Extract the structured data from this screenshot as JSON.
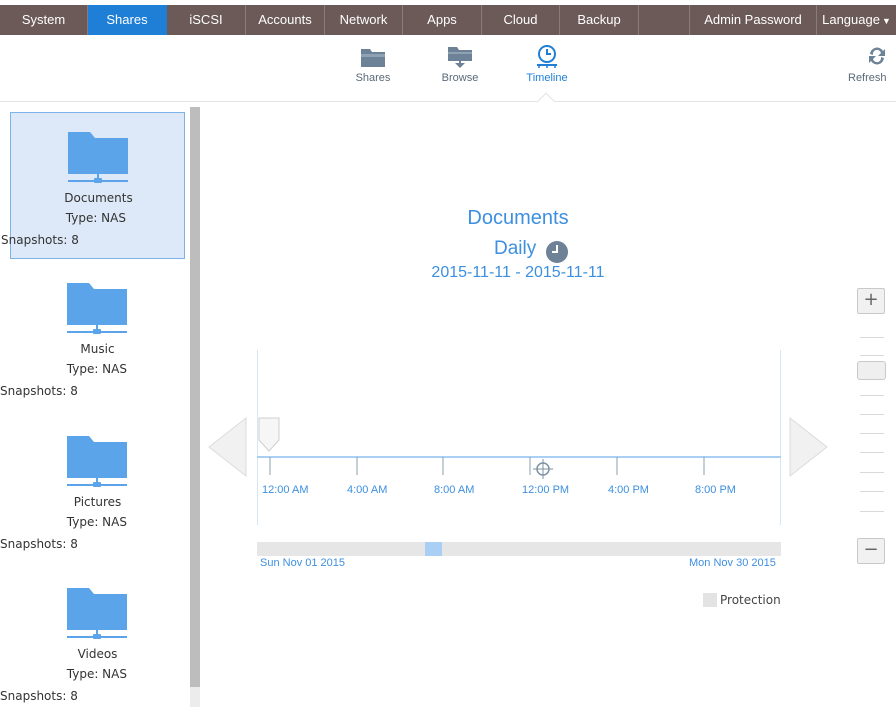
{
  "nav": {
    "tabs": [
      {
        "label": "System"
      },
      {
        "label": "Shares"
      },
      {
        "label": "iSCSI"
      },
      {
        "label": "Accounts"
      },
      {
        "label": "Network"
      },
      {
        "label": "Apps"
      },
      {
        "label": "Cloud"
      },
      {
        "label": "Backup"
      },
      {
        "label": ""
      },
      {
        "label": "Admin Password"
      },
      {
        "label": "Language"
      }
    ],
    "active_tab": "Shares",
    "colors": {
      "bar": "#6b5a57",
      "active": "#1f7fd6"
    }
  },
  "toolbar": {
    "items": [
      {
        "label": "Shares",
        "icon": "folder-icon"
      },
      {
        "label": "Browse",
        "icon": "folder-network-icon"
      },
      {
        "label": "Timeline",
        "icon": "clock-icon"
      }
    ],
    "active": "Timeline",
    "refresh_label": "Refresh"
  },
  "shares": [
    {
      "name": "Documents",
      "type": "Type: NAS",
      "snapshots": "Snapshots: 8",
      "selected": true
    },
    {
      "name": "Music",
      "type": "Type: NAS",
      "snapshots": "Snapshots: 8",
      "selected": false
    },
    {
      "name": "Pictures",
      "type": "Type: NAS",
      "snapshots": "Snapshots: 8",
      "selected": false
    },
    {
      "name": "Videos",
      "type": "Type: NAS",
      "snapshots": "Snapshots: 8",
      "selected": false
    }
  ],
  "timeline": {
    "title": "Documents",
    "frequency": "Daily",
    "date_range": "2015-11-11  -  2015-11-11",
    "hour_labels": [
      "12:00 AM",
      "4:00 AM",
      "8:00 AM",
      "12:00 PM",
      "4:00 PM",
      "8:00 PM"
    ],
    "month_start": "Sun Nov 01 2015",
    "month_end": "Mon Nov 30 2015",
    "legend_label": "Protection",
    "colors": {
      "accent": "#3d8fe0",
      "selection": "#a9cff5"
    }
  },
  "zoom": {
    "in_label": "+",
    "out_label": "−"
  }
}
